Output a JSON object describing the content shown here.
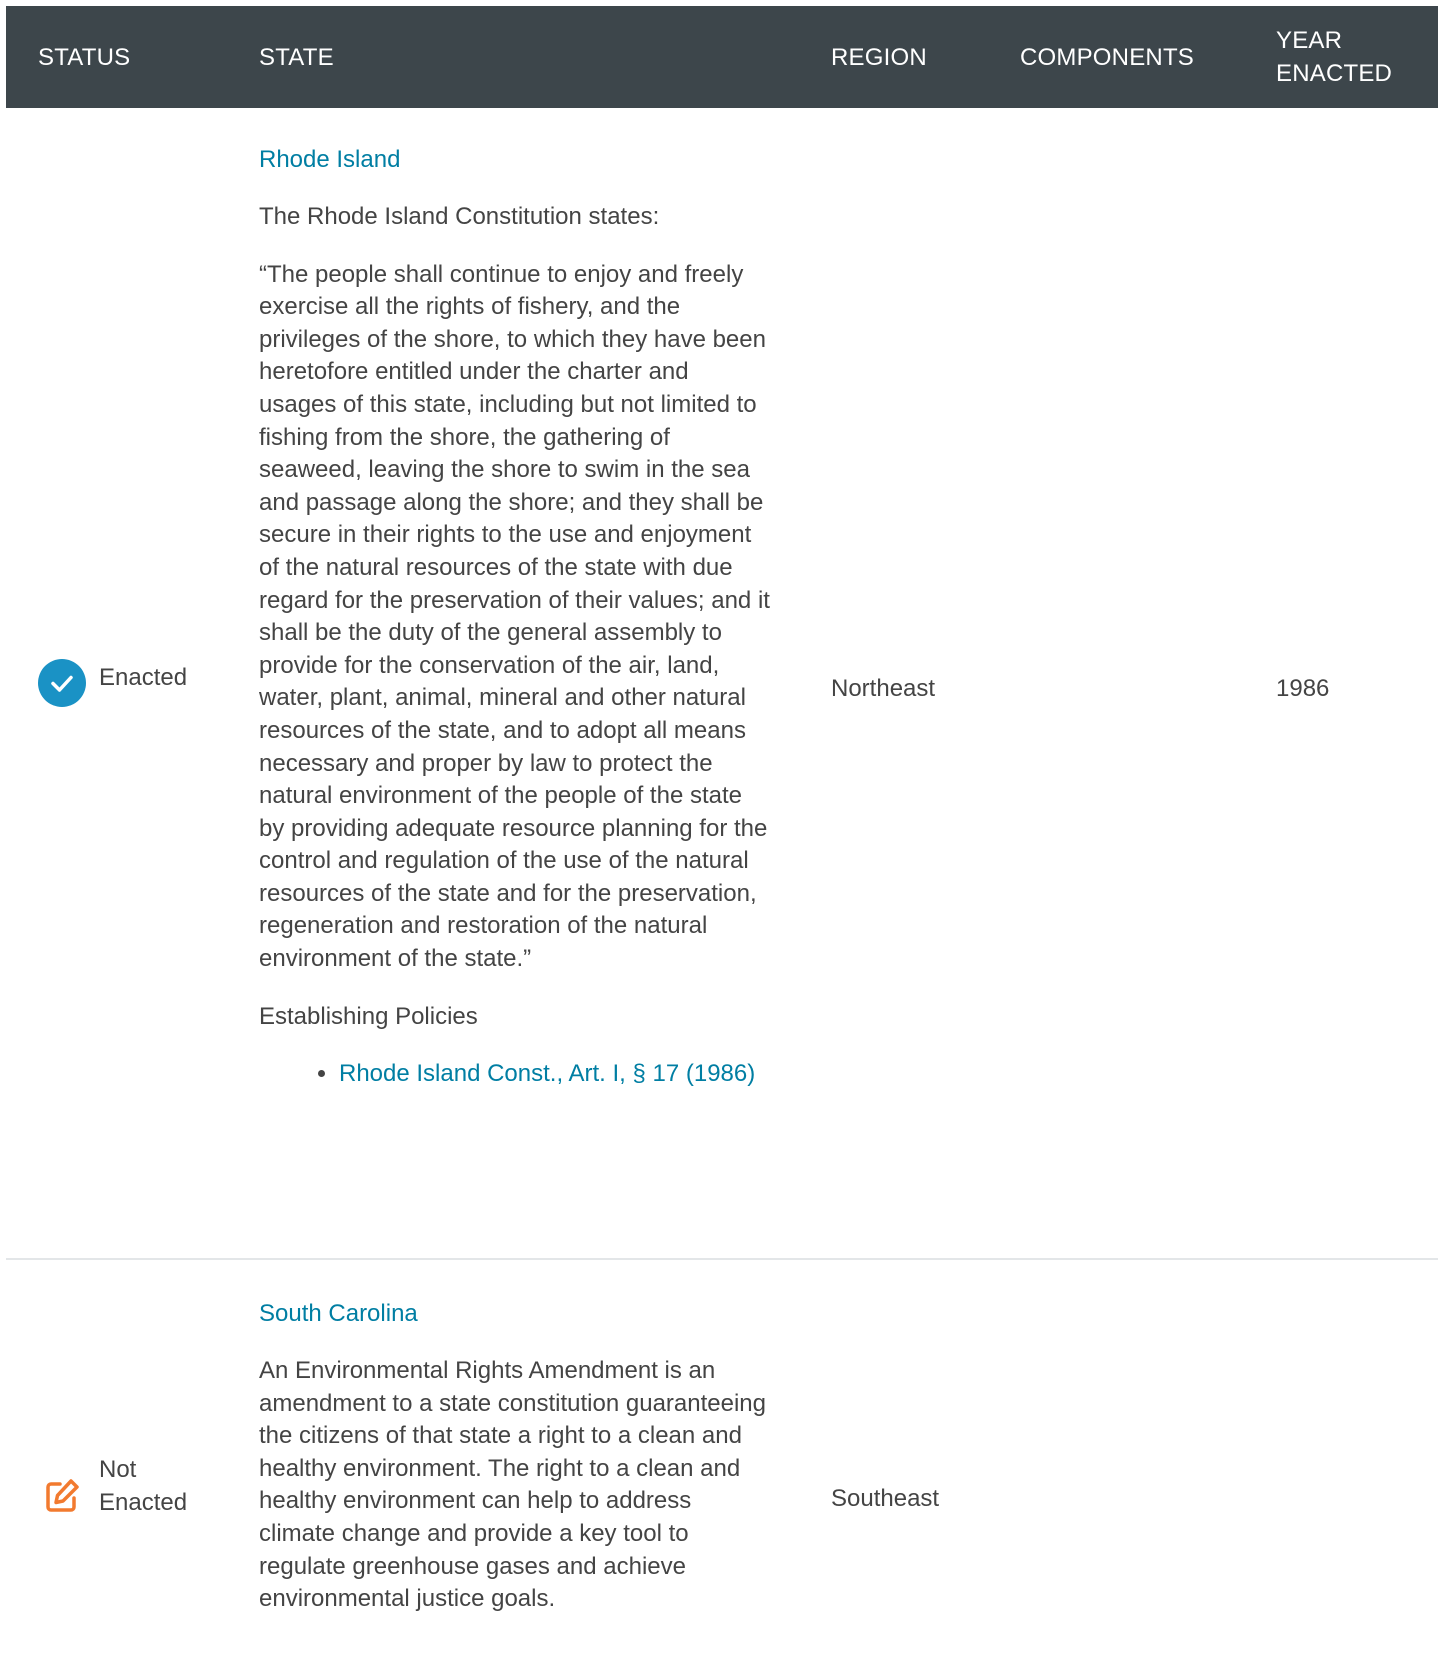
{
  "header": {
    "status": "STATUS",
    "state": "STATE",
    "region": "REGION",
    "components": "COMPONENTS",
    "year_line1": "YEAR",
    "year_line2": "ENACTED"
  },
  "colors": {
    "header_bg": "#3d464b",
    "link": "#007ea3",
    "enacted_icon": "#1a92c5",
    "not_enacted_icon": "#f27a2f"
  },
  "rows": [
    {
      "status": "Enacted",
      "status_icon": "check-circle-icon",
      "state": "Rhode Island",
      "paragraphs": [
        "The Rhode Island Constitution states:",
        "“The people shall continue to enjoy and freely exercise all the rights of fishery, and the privileges of the shore, to which they have been heretofore entitled under the charter and usages of this state, including but not limited to fishing from the shore, the gathering of seaweed, leaving the shore to swim in the sea and passage along the shore; and they shall be secure in their rights to the use and enjoyment of the natural resources of the state with due regard for the preservation of their values; and it shall be the duty of the general assembly to provide for the conservation of the air, land, water, plant, animal, mineral and other natural resources of the state, and to adopt all means necessary and proper by law to protect the natural environment of the people of the state by providing adequate resource planning for the control and regulation of the use of the natural resources of the state and for the preservation, regeneration and restoration of the natural environment of the state.”",
        "Establishing Policies"
      ],
      "policies": [
        "Rhode Island Const., Art. I, § 17 (1986)"
      ],
      "region": "Northeast",
      "components": "",
      "year": "1986"
    },
    {
      "status_line1": "Not",
      "status_line2": "Enacted",
      "status_icon": "edit-icon",
      "state": "South Carolina",
      "paragraphs": [
        "An Environmental Rights Amendment is an amendment to a state constitution guaranteeing the citizens of that state a right to a clean and healthy environment. The right to a clean and healthy environment can help to address climate change and provide a key tool to regulate greenhouse gases and achieve environmental justice goals."
      ],
      "region": "Southeast",
      "components": "",
      "year": ""
    }
  ]
}
